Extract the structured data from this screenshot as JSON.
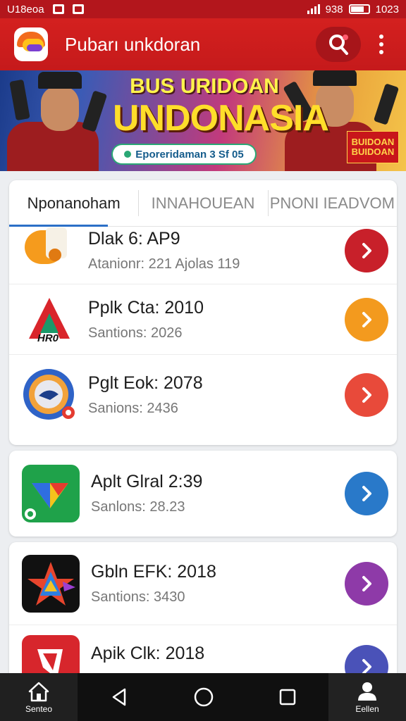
{
  "status_bar": {
    "carrier": "U18eoa",
    "network": "938",
    "time": "1023"
  },
  "app_bar": {
    "title": "Pubarı unkdoran"
  },
  "banner": {
    "line1": "BUS URIDOAN",
    "line2": "UNDONASIA",
    "pill_text": "Eporeridaman 3 Sf 05",
    "badge_text": "BUIDOAN BUIDOAN"
  },
  "tabs": [
    "Nponanoham",
    "INNAHOUEAN",
    "PNONI IEADVOM"
  ],
  "apps": [
    {
      "title": "Dlak 6: AP9",
      "subtitle": "Atanionr: 221 Ajolas 119",
      "icon": "orange-fox-icon",
      "button_color": "#c8202a"
    },
    {
      "title": "Pplk Cta: 2010",
      "subtitle": "Santions: 2026",
      "icon": "red-a-logo-icon",
      "button_color": "#f39a1e"
    },
    {
      "title": "Pglt Eok: 2078",
      "subtitle": "Sanions: 2436",
      "icon": "circle-badge-icon",
      "button_color": "#e84a3a"
    },
    {
      "title": "Aplt Glral 2:39",
      "subtitle": "Sanlons: 28.23",
      "icon": "green-play-icon",
      "button_color": "#2979c9"
    },
    {
      "title": "Gbln EFK: 2018",
      "subtitle": "Santions: 3430",
      "icon": "color-star-icon",
      "button_color": "#8e3aa8"
    },
    {
      "title": "Apik Clk: 2018",
      "subtitle": "",
      "icon": "red-folder-icon",
      "button_color": "#4a52b8"
    }
  ],
  "bottom_nav": {
    "home_label": "Senteo",
    "profile_label": "Eellen"
  }
}
